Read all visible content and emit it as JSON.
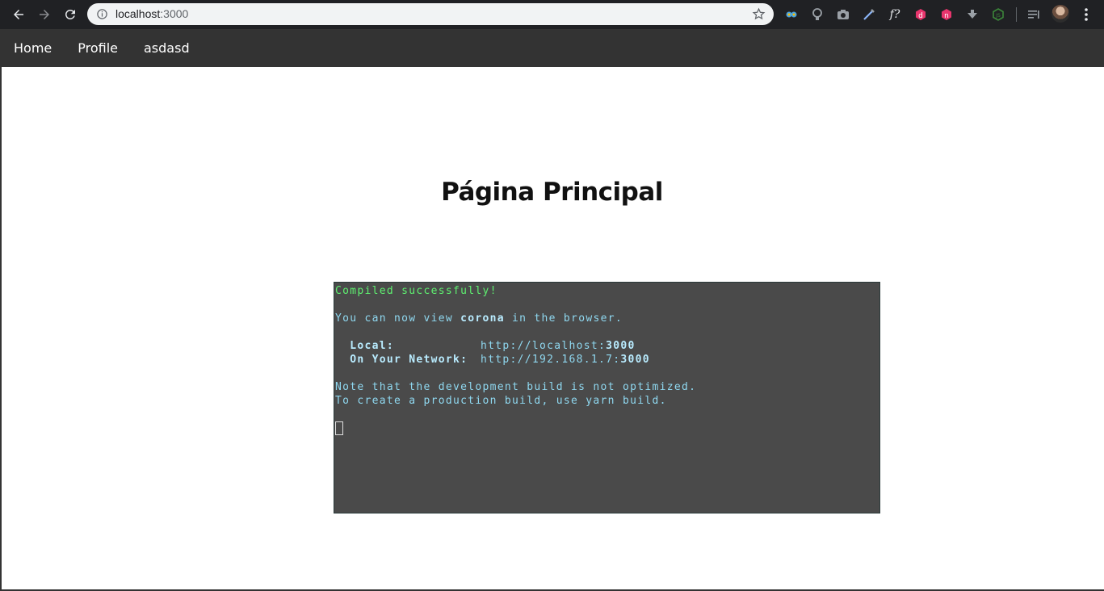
{
  "browser": {
    "url_host": "localhost",
    "url_port": ":3000",
    "extensions": [
      {
        "name": "owl-extension-icon",
        "color": "#4aa3df"
      },
      {
        "name": "lightbulb-extension-icon",
        "color": "#9aa0a6"
      },
      {
        "name": "camera-extension-icon",
        "color": "#9aa0a6"
      },
      {
        "name": "eyedropper-extension-icon",
        "color": "#8ab4f8"
      },
      {
        "name": "font-finder-extension-icon",
        "label": "f?"
      },
      {
        "name": "d-badge-extension-icon",
        "label": "d",
        "color": "#e8356d"
      },
      {
        "name": "n-badge-extension-icon",
        "label": "n",
        "color": "#e8356d"
      },
      {
        "name": "download-extension-icon",
        "color": "#9aa0a6"
      },
      {
        "name": "nodejs-extension-icon",
        "label": "JS",
        "color": "#3c873a"
      },
      {
        "name": "reading-list-icon",
        "color": "#9aa0a6"
      }
    ]
  },
  "navbar": {
    "links": [
      "Home",
      "Profile",
      "asdasd"
    ]
  },
  "page": {
    "title": "Página Principal"
  },
  "terminal": {
    "line1": "Compiled successfully!",
    "line2_pre": "You can now view ",
    "line2_app": "corona",
    "line2_post": " in the browser.",
    "local_label": "  Local:",
    "local_url": "http://localhost:",
    "local_port": "3000",
    "network_label": "  On Your Network:",
    "network_url": "http://192.168.1.7:",
    "network_port": "3000",
    "note1": "Note that the development build is not optimized.",
    "note2": "To create a production build, use yarn build."
  },
  "colors": {
    "navbar_bg": "#333333",
    "terminal_bg": "#4a4a4a",
    "terminal_text": "#8fd8f0",
    "success_green": "#5ef070"
  }
}
